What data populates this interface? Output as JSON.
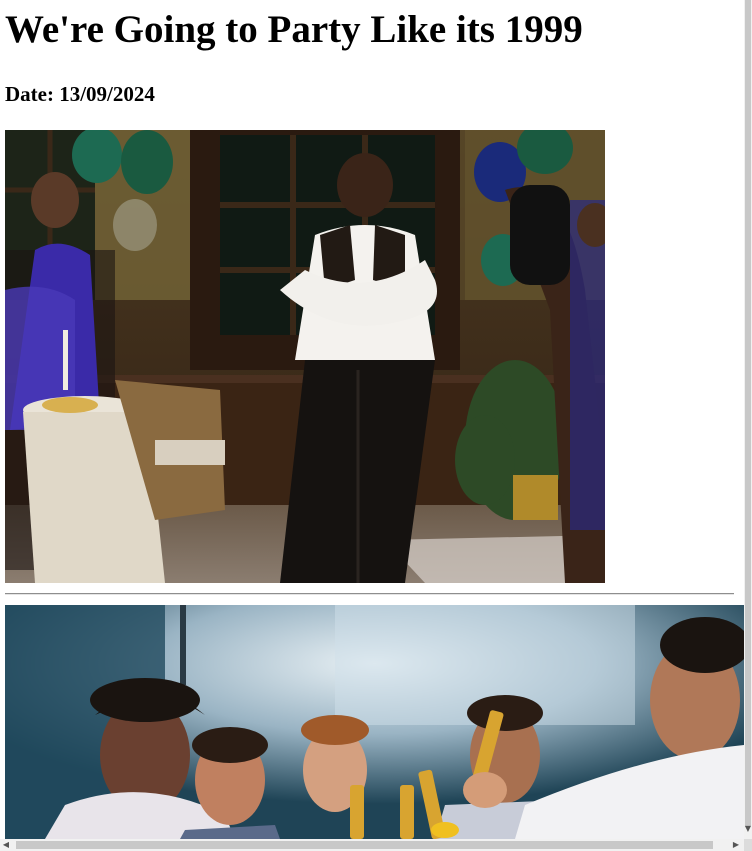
{
  "page": {
    "title": "We're Going to Party Like its 1999",
    "date_line": "Date: 13/09/2024"
  },
  "images": [
    {
      "name": "dance-gif-image",
      "description_icon": "photo"
    },
    {
      "name": "friends-toast-image",
      "description_icon": "photo"
    }
  ],
  "scrollbars": {
    "down_arrow": "▼",
    "left_arrow": "◀",
    "right_arrow": "▶"
  }
}
